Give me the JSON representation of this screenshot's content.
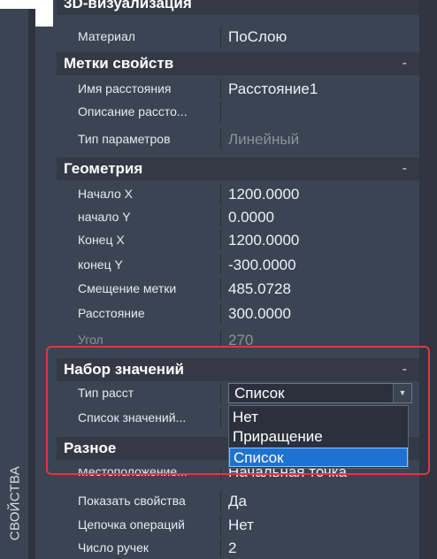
{
  "side_tab": {
    "label": "СВОЙСТВА"
  },
  "sections": {
    "viz": {
      "title": "3D-визуализация"
    },
    "labels": {
      "title": "Метки свойств",
      "toggle": "-"
    },
    "geom": {
      "title": "Геометрия",
      "toggle": "-"
    },
    "valueset": {
      "title": "Набор значений",
      "toggle": "-"
    },
    "misc": {
      "title": "Разное",
      "toggle": "-"
    }
  },
  "rows": {
    "material": {
      "key": "Материал",
      "value": "ПоСлою"
    },
    "dist_name": {
      "key": "Имя расстояния",
      "value": "Расстояние1"
    },
    "dist_desc": {
      "key": "Описание рассто...",
      "value": ""
    },
    "param_type": {
      "key": "Тип параметров",
      "value": "Линейный"
    },
    "start_x": {
      "key": "Начало X",
      "value": "1200.0000"
    },
    "start_y": {
      "key": "начало Y",
      "value": "0.0000"
    },
    "end_x": {
      "key": "Конец X",
      "value": "1200.0000"
    },
    "end_y": {
      "key": " конец Y",
      "value": "-300.0000"
    },
    "label_offset": {
      "key": "Смещение метки",
      "value": "485.0728"
    },
    "distance": {
      "key": "Расстояние",
      "value": "300.0000"
    },
    "angle": {
      "key": "Угол",
      "value": "270"
    },
    "dist_type": {
      "key": "Тип расст",
      "value": "Список"
    },
    "value_list": {
      "key": "Список значений...",
      "value": ""
    },
    "location": {
      "key": "Местоположение...",
      "value": "Начальная точка"
    },
    "show_props": {
      "key": "Показать свойства",
      "value": "Да"
    },
    "op_chain": {
      "key": "Цепочка операций",
      "value": "Нет"
    },
    "grip_count": {
      "key": "Число ручек",
      "value": "2"
    }
  },
  "dropdown": {
    "selected": "Список",
    "arrow": "▼",
    "options": [
      "Нет",
      "Приращение",
      "Список"
    ]
  }
}
